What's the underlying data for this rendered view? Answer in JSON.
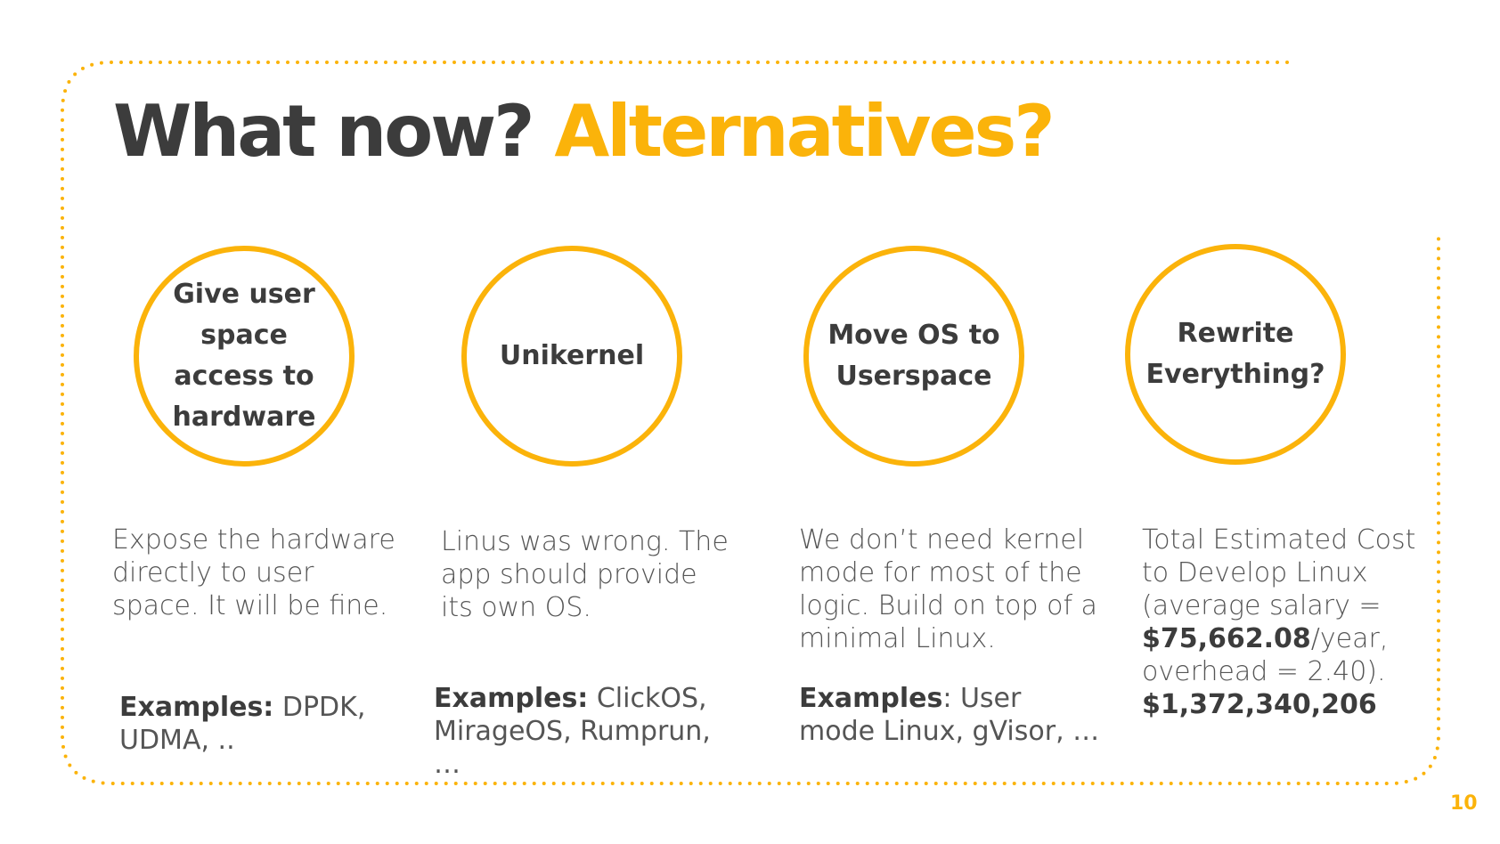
{
  "slide": {
    "title_main": "What now?",
    "title_accent": "Alternatives?",
    "page_number": "10",
    "accent_color": "#fbb30a",
    "text_color": "#3c3c3c"
  },
  "columns": [
    {
      "circle_label": "Give user space access to hardware",
      "description": "Expose the hardware directly to user space. It will be fine.",
      "examples_label": "Examples:",
      "examples_text": " DPDK, UDMA, .."
    },
    {
      "circle_label": "Unikernel",
      "description": "Linus was wrong. The app should provide its own OS.",
      "examples_label": "Examples:",
      "examples_text": " ClickOS, MirageOS, Rumprun, …"
    },
    {
      "circle_label": "Move OS to Userspace",
      "description": "We don’t need kernel mode for most of the logic. Build on top of a minimal Linux.",
      "examples_label": "Examples",
      "examples_text": ": User mode Linux, gVisor, …"
    },
    {
      "circle_label": "Rewrite Everything?",
      "description_pre": "Total Estimated Cost to Develop Linux (average salary = ",
      "salary": "$75,662.08",
      "description_post": "/year, overhead = 2.40).",
      "total_cost": "$1,372,340,206"
    }
  ]
}
